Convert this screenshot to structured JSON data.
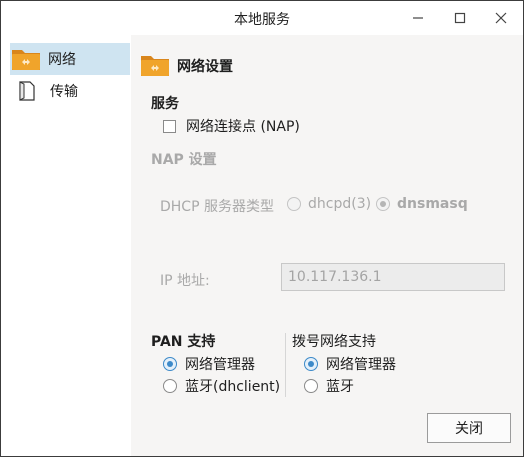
{
  "window": {
    "title": "本地服务",
    "controls": {
      "minimize": "—",
      "maximize": "☐",
      "close": "✕"
    }
  },
  "sidebar": {
    "items": [
      {
        "label": "网络",
        "icon": "folder-icon",
        "selected": true
      },
      {
        "label": "传输",
        "icon": "document-icon",
        "selected": false
      }
    ]
  },
  "main": {
    "heading": "网络设置",
    "heading_icon": "folder-icon",
    "services": {
      "label": "服务",
      "nap_checkbox_label": "网络连接点 (NAP)",
      "nap_checked": false
    },
    "nap_settings": {
      "label": "NAP 设置",
      "dhcp_label": "DHCP 服务器类型",
      "options": [
        {
          "label": "dhcpd(3)",
          "selected": false
        },
        {
          "label": "dnsmasq",
          "selected": true
        }
      ],
      "ip_label": "IP 地址:",
      "ip_value": "10.117.136.1"
    },
    "pan": {
      "label": "PAN 支持",
      "options": [
        {
          "label": "网络管理器",
          "selected": true
        },
        {
          "label": "蓝牙(dhclient)",
          "selected": false
        }
      ]
    },
    "dialup": {
      "label": "拨号网络支持",
      "options": [
        {
          "label": "网络管理器",
          "selected": true
        },
        {
          "label": "蓝牙",
          "selected": false
        }
      ]
    },
    "close_button": "关闭"
  },
  "colors": {
    "selection": "#cfe4f1",
    "accent": "#3d8ac9",
    "folder": "#f0a42b",
    "disabled_text": "#a9a9a9"
  }
}
